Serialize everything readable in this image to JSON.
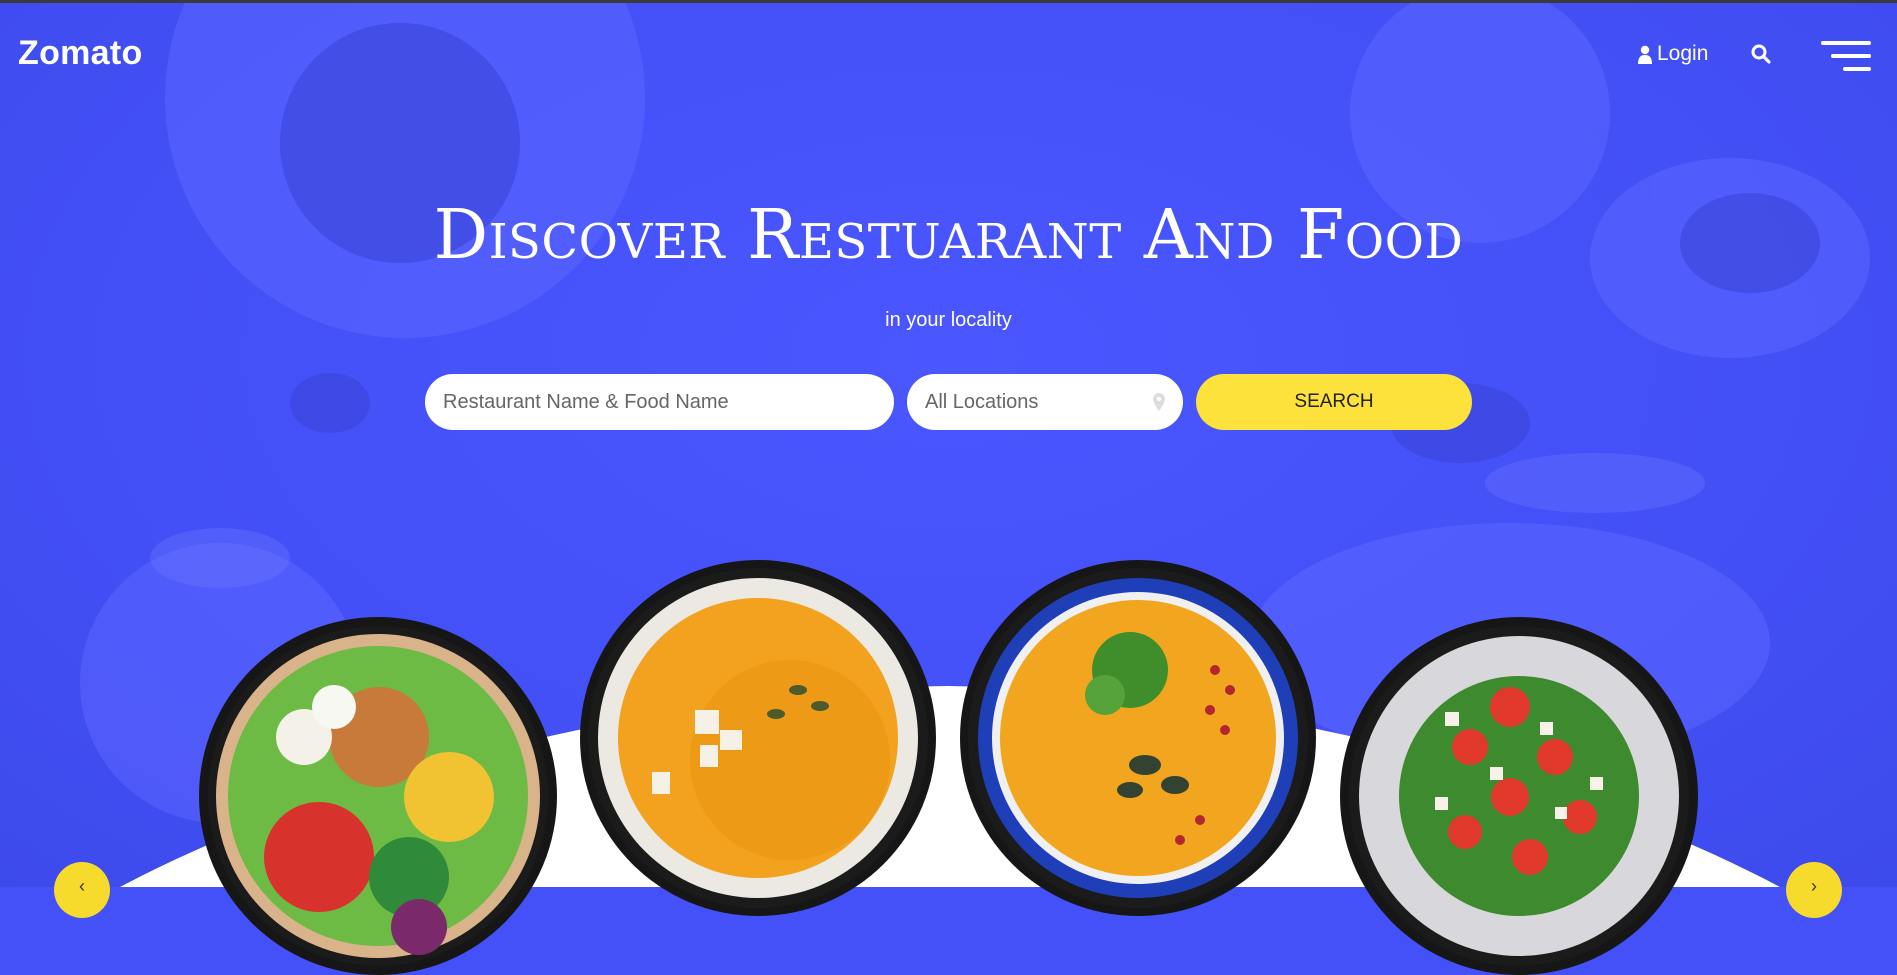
{
  "brand": {
    "logo": "Zomato"
  },
  "nav": {
    "login_label": "Login"
  },
  "hero": {
    "title": "Discover Restuarant And Food",
    "subtitle": "in your locality"
  },
  "search": {
    "food_placeholder": "Restaurant Name & Food Name",
    "location_placeholder": "All Locations",
    "button_label": "SEARCH"
  },
  "carousel": {
    "prev_label": "‹",
    "next_label": "›",
    "items": [
      {
        "name": "salad-bowl-tofu"
      },
      {
        "name": "pumpkin-soup-feta"
      },
      {
        "name": "pumpkin-soup-seeds"
      },
      {
        "name": "tomato-feta-salad"
      }
    ]
  },
  "colors": {
    "accent": "#4451f8",
    "button": "#fde23b",
    "text": "#ffffff"
  },
  "icons": [
    "user-icon",
    "search-icon",
    "menu-icon",
    "location-pin-icon",
    "chevron-left-icon",
    "chevron-right-icon"
  ]
}
